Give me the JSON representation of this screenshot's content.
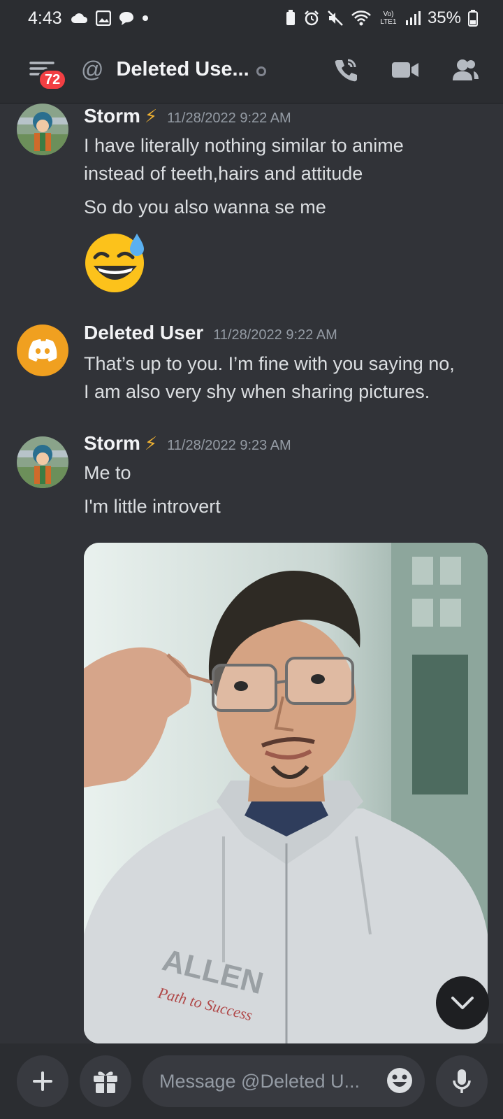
{
  "status_bar": {
    "time": "4:43",
    "battery": "35%",
    "network": "Vo) LTE1"
  },
  "header": {
    "badge": "72",
    "at_symbol": "@",
    "title": "Deleted Use...",
    "icons": [
      "call-icon",
      "video-icon",
      "members-icon"
    ]
  },
  "messages": [
    {
      "author": "Storm",
      "timestamp": "11/28/2022 9:22 AM",
      "lines": [
        "I have literally nothing similar to anime",
        "instead of teeth,hairs and attitude",
        "So do you also wanna se me"
      ],
      "emoji": "grinning-sweat-emoji"
    },
    {
      "author": "Deleted User",
      "timestamp": "11/28/2022 9:22 AM",
      "lines": [
        "That’s up to you. I’m fine with you saying no,",
        "I am also very shy when sharing pictures."
      ]
    },
    {
      "author": "Storm",
      "timestamp": "11/28/2022 9:23 AM",
      "lines": [
        "Me to",
        "I'm little introvert"
      ],
      "attachment": "photo",
      "hoodie_text": [
        "ALLEN",
        "Path to Success"
      ]
    }
  ],
  "composer": {
    "placeholder": "Message @Deleted U..."
  },
  "colors": {
    "background": "#313338",
    "header": "#2b2d31",
    "badge": "#f23f43",
    "discord_orange": "#f0a020"
  }
}
